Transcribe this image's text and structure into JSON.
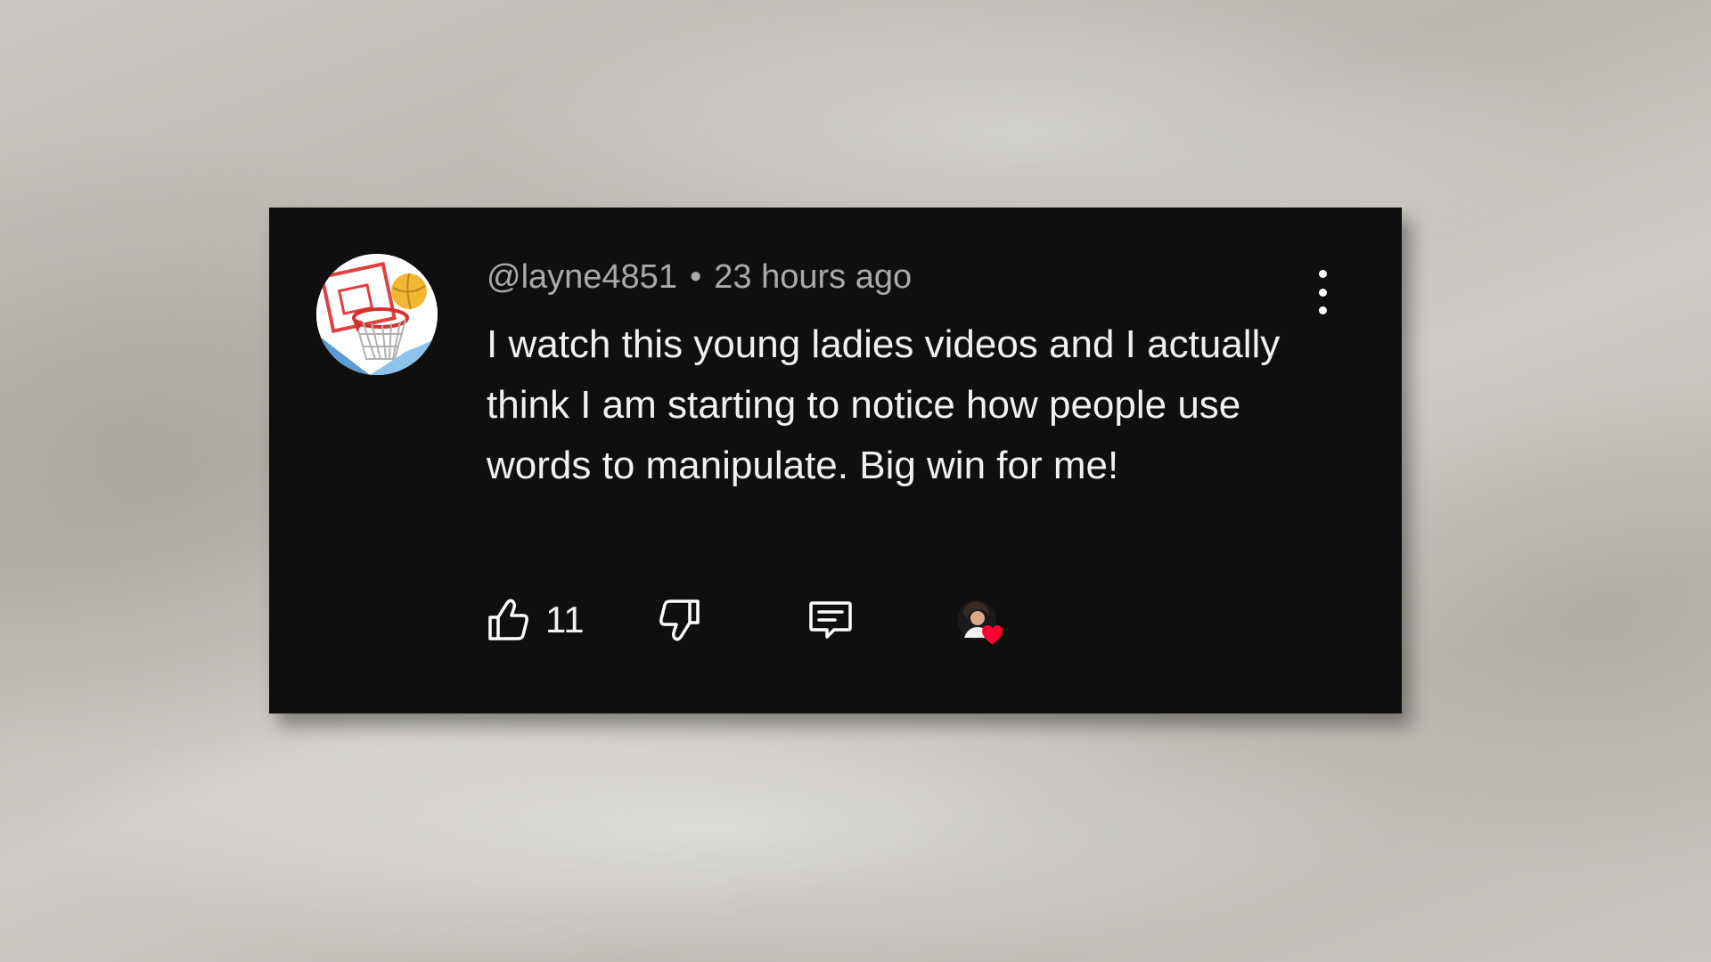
{
  "comment": {
    "author": "@layne4851",
    "separator": "•",
    "timestamp": "23 hours ago",
    "text": "I watch this young ladies videos and I actually think I am starting to notice how people use words to manipulate. Big win for me!",
    "like_count": "11",
    "avatar_icon": "basketball-hoop-avatar",
    "heart_color": "#ff0033"
  },
  "icons": {
    "like": "thumbs-up-icon",
    "dislike": "thumbs-down-icon",
    "reply": "comment-reply-icon",
    "more": "vertical-ellipsis-icon",
    "creator_heart": "creator-heart-badge"
  }
}
